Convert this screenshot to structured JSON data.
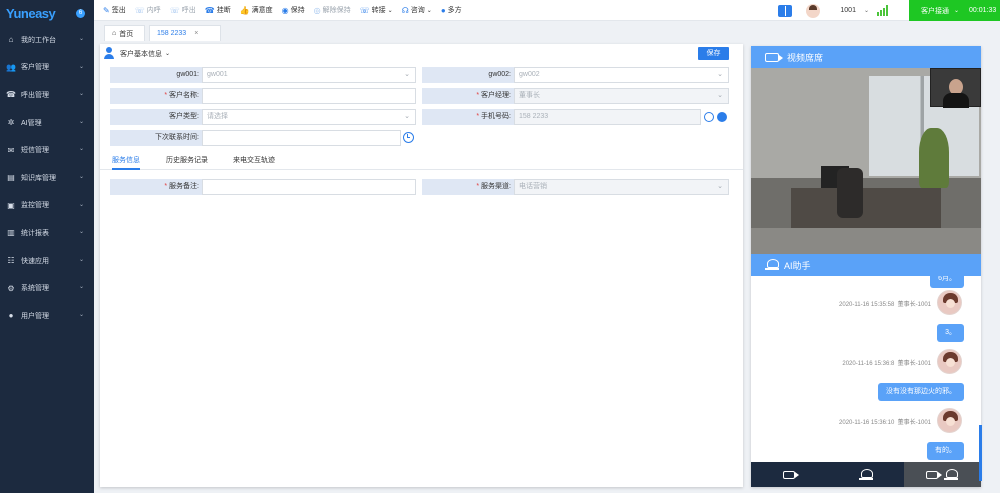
{
  "brand": {
    "logo": "Yuneasy",
    "badge": "6"
  },
  "sidebar": {
    "items": [
      {
        "label": "我的工作台",
        "icon": "home-icon"
      },
      {
        "label": "客户管理",
        "icon": "users-icon"
      },
      {
        "label": "呼出管理",
        "icon": "phone-out-icon"
      },
      {
        "label": "AI管理",
        "icon": "ai-icon"
      },
      {
        "label": "短信管理",
        "icon": "mail-icon"
      },
      {
        "label": "知识库管理",
        "icon": "knowledge-icon"
      },
      {
        "label": "监控管理",
        "icon": "monitor-icon"
      },
      {
        "label": "统计报表",
        "icon": "chart-icon"
      },
      {
        "label": "快速应用",
        "icon": "app-icon"
      },
      {
        "label": "系统管理",
        "icon": "gear-icon"
      },
      {
        "label": "用户管理",
        "icon": "user-icon"
      }
    ]
  },
  "toolbar": {
    "items": [
      {
        "label": "签出",
        "icon": "signout-icon",
        "disabled": false
      },
      {
        "label": "内呼",
        "icon": "inner-call-icon",
        "disabled": true
      },
      {
        "label": "呼出",
        "icon": "outbound-call-icon",
        "disabled": true
      },
      {
        "label": "挂断",
        "icon": "hangup-icon",
        "disabled": false
      },
      {
        "label": "满意度",
        "icon": "satisfaction-icon",
        "disabled": false
      },
      {
        "label": "保持",
        "icon": "hold-icon",
        "disabled": false
      },
      {
        "label": "解除保持",
        "icon": "unhold-icon",
        "disabled": true
      },
      {
        "label": "转接",
        "icon": "transfer-icon",
        "disabled": false
      },
      {
        "label": "咨询",
        "icon": "consult-icon",
        "disabled": false
      },
      {
        "label": "多方",
        "icon": "multiparty-icon",
        "disabled": false
      }
    ],
    "extension": "1001",
    "status_label": "客户接通",
    "status_time": "00:01:33",
    "status_color": "#1ec723"
  },
  "tabs": {
    "home": "首页",
    "phone": "158        2233",
    "close": "×"
  },
  "form": {
    "section_title": "客户基本信息",
    "save_label": "保存",
    "gw001_label": "gw001:",
    "gw001_value": "gw001",
    "gw002_label": "gw002:",
    "gw002_value": "gw002",
    "name_label": "客户名称:",
    "name_value": "",
    "manager_label": "客户经理:",
    "manager_value": "董事长",
    "type_label": "客户类型:",
    "type_value": "请选择",
    "mobile_label": "手机号码:",
    "mobile_value": "158        2233",
    "next_contact_label": "下次联系时间:",
    "next_contact_value": "",
    "remark_label": "服务备注:",
    "remark_value": "",
    "channel_label": "服务渠道:",
    "channel_value": "电话营销",
    "required_mark": "*"
  },
  "subtabs": [
    "服务信息",
    "历史服务记录",
    "来电交互轨迹"
  ],
  "video_panel": {
    "title": "视频席席"
  },
  "ai_panel": {
    "title": "AI助手",
    "messages": [
      {
        "type": "bubble",
        "text": "6月。"
      },
      {
        "type": "meta",
        "time": "2020-11-16 15:35:58",
        "sender": "董事长-1001"
      },
      {
        "type": "bubble",
        "text": "3。"
      },
      {
        "type": "meta",
        "time": "2020-11-16 15:36:8",
        "sender": "董事长-1001"
      },
      {
        "type": "bubble",
        "text": "没有没有那边火的邪。"
      },
      {
        "type": "meta",
        "time": "2020-11-16 15:36:10",
        "sender": "董事长-1001"
      },
      {
        "type": "bubble",
        "text": "有的。"
      }
    ]
  }
}
